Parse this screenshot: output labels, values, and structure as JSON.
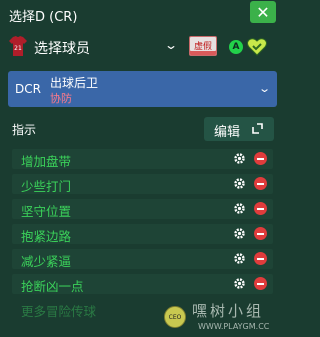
{
  "header": {
    "title": "选择D (CR)",
    "close_label": "✕"
  },
  "player": {
    "label": "选择球员",
    "jersey_number": "21",
    "status_tag": "虚假",
    "indicator_letter": "A"
  },
  "position": {
    "code": "DCR",
    "name": "出球后卫",
    "role": "协防"
  },
  "instructions": {
    "section_label": "指示",
    "edit_label": "编辑",
    "items": [
      "增加盘带",
      "少些打门",
      "坚守位置",
      "抱紧边路",
      "减少紧逼",
      "抢断凶一点"
    ],
    "more_label": "更多冒险传球"
  },
  "watermark": {
    "text_cn": "嘿树小组",
    "url": "WWW.PLAYGM.CC",
    "badge": "CEO"
  },
  "colors": {
    "background": "#1a3c30",
    "accent_green": "#3bd25a",
    "position_blue": "#3a67a8",
    "remove_red": "#e03c3c"
  }
}
